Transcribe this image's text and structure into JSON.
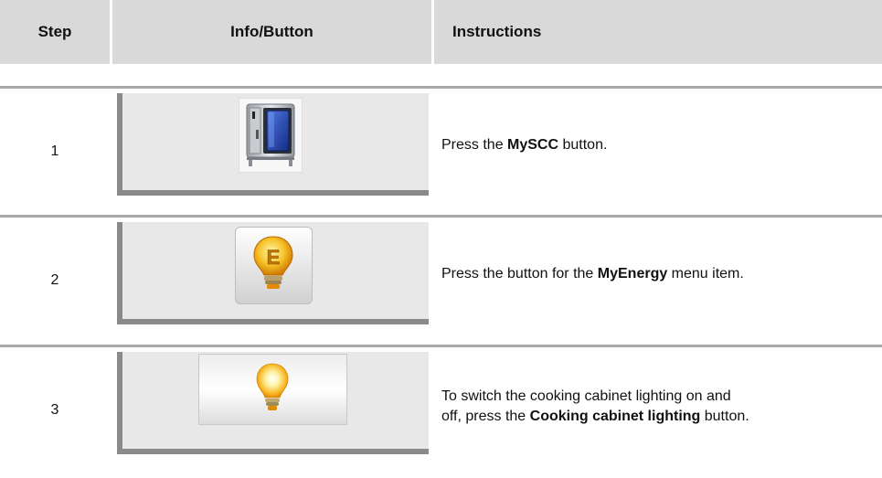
{
  "header": {
    "step": "Step",
    "info": "Info/Button",
    "instructions": "Instructions"
  },
  "rows": [
    {
      "step": "1",
      "button_icon": "combi-oven-icon",
      "text_before": "Press the ",
      "bold": "MySCC",
      "text_after": " button."
    },
    {
      "step": "2",
      "button_icon": "energy-bulb-icon",
      "text_before": "Press the button for the ",
      "bold": "MyEnergy",
      "text_after": " menu item."
    },
    {
      "step": "3",
      "button_icon": "light-bulb-icon",
      "text_line1": "To switch the cooking cabinet lighting on and",
      "text_before": "off, press the ",
      "bold": "Cooking cabinet lighting",
      "text_after": " button."
    }
  ],
  "icon_letter": "E",
  "colors": {
    "header_bg": "#d9d9d9",
    "panel_bg": "#e8e8e8",
    "rule": "#a8a8a8",
    "oven_blue": "#1f3fa8",
    "bulb_yellow": "#f2b705"
  }
}
